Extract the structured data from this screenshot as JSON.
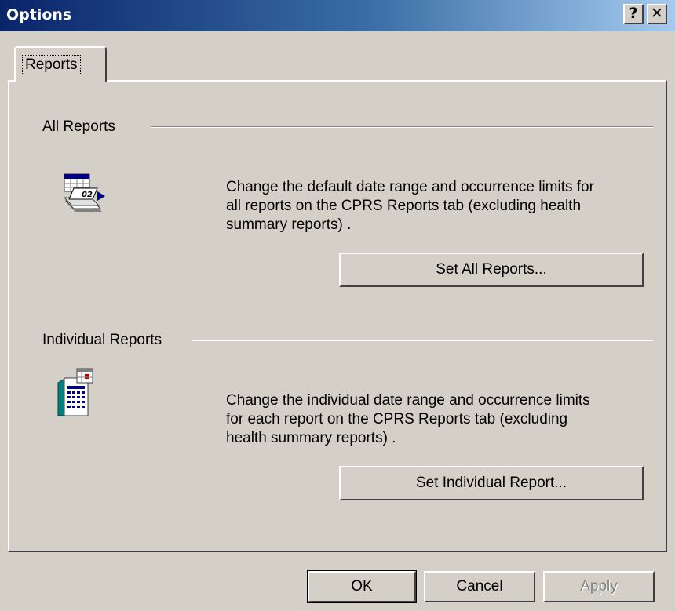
{
  "window": {
    "title": "Options",
    "help_glyph": "?",
    "close_glyph": "✕"
  },
  "tabs": [
    {
      "label": "Reports",
      "selected": true
    }
  ],
  "all_reports": {
    "heading": "All Reports",
    "icon": "report-date-icon",
    "description_lines": [
      "Change the default date range and occurrence limits for",
      "all reports on the CPRS Reports tab (excluding health",
      "summary reports) ."
    ],
    "button_label": "Set All Reports..."
  },
  "individual_reports": {
    "heading": "Individual Reports",
    "icon": "report-calendar-icon",
    "description_lines": [
      "Change the individual date range and occurrence limits",
      "for each report on the CPRS Reports tab (excluding",
      "health summary reports) ."
    ],
    "button_label": "Set Individual Report..."
  },
  "footer": {
    "ok_label": "OK",
    "cancel_label": "Cancel",
    "apply_label": "Apply",
    "apply_enabled": false
  },
  "colors": {
    "face": "#d4d0c8",
    "title_start": "#0a246a",
    "title_end": "#a6caf0"
  }
}
